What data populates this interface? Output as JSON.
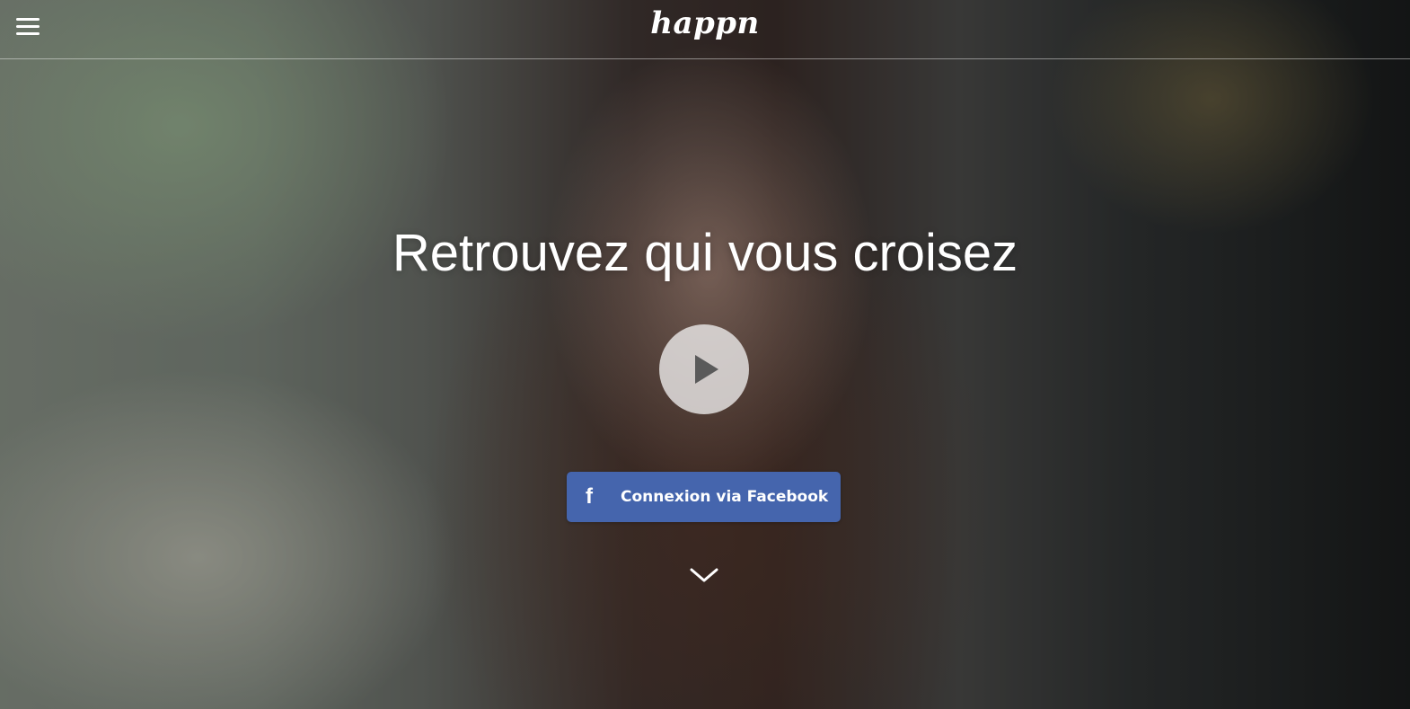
{
  "header": {
    "logo_text": "happn",
    "menu_icon": "hamburger-menu-icon"
  },
  "hero": {
    "headline": "Retrouvez qui vous croisez",
    "play_icon": "play-icon",
    "facebook_button": {
      "icon": "f",
      "label": "Connexion via Facebook",
      "color": "#4565ad"
    },
    "scroll_icon": "chevron-down-icon"
  }
}
